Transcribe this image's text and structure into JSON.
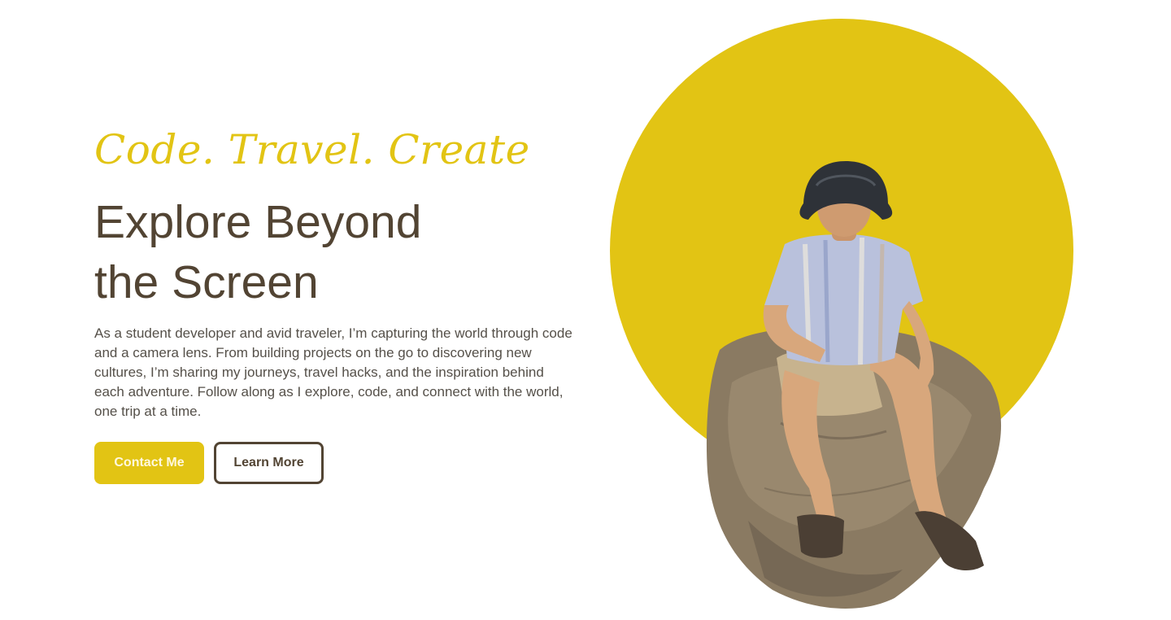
{
  "hero": {
    "tagline": "Code. Travel. Create",
    "headline_line1": "Explore Beyond",
    "headline_line2": "the Screen",
    "description": "As a student developer and avid traveler, I’m capturing the world through code and a camera lens. From building projects on the go to discovering new cultures, I’m sharing my journeys, travel hacks, and the inspiration behind each adventure. Follow along as I explore, code, and connect with the world, one trip at a time.",
    "primary_button": "Contact Me",
    "secondary_button": "Learn More"
  },
  "colors": {
    "accent": "#e2c414",
    "heading": "#524433",
    "body_text": "#555049",
    "background": "#ffffff"
  }
}
